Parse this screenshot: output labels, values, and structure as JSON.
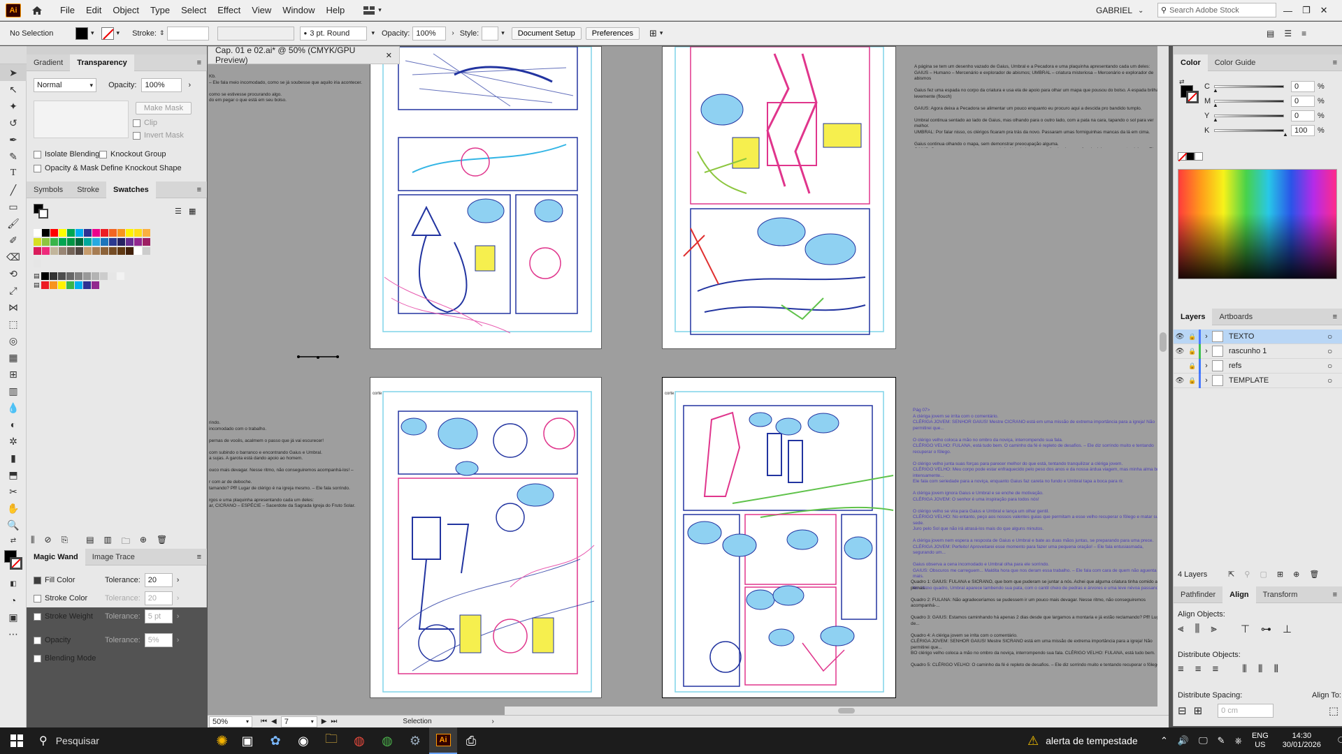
{
  "app": {
    "logo": "Ai",
    "user": "GABRIEL",
    "search_placeholder": "Search Adobe Stock"
  },
  "menu": [
    "File",
    "Edit",
    "Object",
    "Type",
    "Select",
    "Effect",
    "View",
    "Window",
    "Help"
  ],
  "control": {
    "selection": "No Selection",
    "stroke_label": "Stroke:",
    "brush": "3 pt. Round",
    "opacity_label": "Opacity:",
    "opacity": "100%",
    "style_label": "Style:",
    "doc_setup": "Document Setup",
    "preferences": "Preferences"
  },
  "document": {
    "tab_title": "Cap. 01 e 02.ai* @ 50% (CMYK/GPU Preview)"
  },
  "transparency_panel": {
    "tabs": [
      "Gradient",
      "Transparency"
    ],
    "blend_mode": "Normal",
    "opacity_label": "Opacity:",
    "opacity": "100%",
    "make_mask": "Make Mask",
    "clip": "Clip",
    "invert_mask": "Invert Mask",
    "isolate": "Isolate Blending",
    "knockout": "Knockout Group",
    "opacity_mask": "Opacity & Mask Define Knockout Shape"
  },
  "swatches_panel": {
    "tabs": [
      "Symbols",
      "Stroke",
      "Swatches"
    ]
  },
  "magic_wand_panel": {
    "tabs": [
      "Magic Wand",
      "Image Trace"
    ],
    "fill_color": "Fill Color",
    "stroke_color": "Stroke Color",
    "stroke_weight": "Stroke Weight",
    "opacity": "Opacity",
    "blending_mode": "Blending Mode",
    "tolerance_label": "Tolerance:",
    "fill_tolerance": "20",
    "stroke_color_tolerance": "20",
    "stroke_weight_tolerance": "5 pt",
    "opacity_tolerance": "5%"
  },
  "color_panel": {
    "tabs": [
      "Color",
      "Color Guide"
    ],
    "channels": [
      {
        "label": "C",
        "value": "0",
        "unit": "%"
      },
      {
        "label": "M",
        "value": "0",
        "unit": "%"
      },
      {
        "label": "Y",
        "value": "0",
        "unit": "%"
      },
      {
        "label": "K",
        "value": "100",
        "unit": "%"
      }
    ]
  },
  "layers_panel": {
    "tabs": [
      "Layers",
      "Artboards"
    ],
    "layers": [
      {
        "name": "TEXTO",
        "color": "#4a7bff"
      },
      {
        "name": "rascunho 1",
        "color": "#3cc050"
      },
      {
        "name": "refs",
        "color": "#3c78ff"
      },
      {
        "name": "TEMPLATE",
        "color": "#4a7bff"
      }
    ],
    "count": "4 Layers"
  },
  "align_panel": {
    "tabs": [
      "Pathfinder",
      "Align",
      "Transform"
    ],
    "align_objects": "Align Objects:",
    "distribute_objects": "Distribute Objects:",
    "distribute_spacing": "Distribute Spacing:",
    "align_to": "Align To:",
    "spacing_value": "0 cm"
  },
  "status": {
    "zoom": "50%",
    "page": "7",
    "tool": "Selection"
  },
  "artboards": {
    "label_corte": "corte"
  },
  "script_text": {
    "top_left": "Kb.\n– Ele fala meio incomodado, como se já soubesse que aquilo iria acontecer.\n\ncomo se estivesse procurando algo.\ndo em pegar o que está em seu bolso.",
    "mid_left": "rindo.\nincomodado com o trabalho.\n\npernas de vocês, acalmem o passo que já vai escurecer!\n\ncom subindo o barranco e encontrando Gaius e Umbral.\na sujas. A garota está dando apoio ao homem.\n\nouco mais devagar. Nesse ritmo, não conseguiremos acompanhá-los! –\n\nr com ar de deboche.\ntamando? Pff! Lugar de clérigo é na igreja mesmo. – Ele fala sorrindo.\n\nrgos e uma plaquinha apresentando cada um deles:\nar, CICRANO – ESPÉCIE – Sacerdote da Sagrada Igreja do Fruto Solar.",
    "top_right": "A página se tem um desenho vazado de Gaius, Umbral e a Pecadora e uma plaquinha apresentando cada um deles:\nGAIUS – Humano – Mercenário e explorador de abismos; UMBRAL – criatura misteriosa – Mercenário e explorador de abismos\n\nGaius fez uma espada no corpo da criatura e usa ela de apoio para olhar um mapa que pousou do bolso. A espada brilha levemente (flouch)\n\nGAIUS: Agora deixa a Pecadora se alimentar um pouco enquanto eu procuro aqui a descida pro bandido tumplo.\n\nUmbral continua sentado ao lado de Gaius, mas olhando para o outro lado, com a pata na cara, tapando o sol para ver melhor.\nUMBRAL: Por falar nisso, os clérigos ficaram pra trás da novo. Passaram umas formiguinhas mancas da lá em cima.\n\nGaius continua olhando o mapa, sem demonstrar preocupação alguma.\nGAIUS: Com sorte, aparece algum tamanduá abissal gigante e confunda eles com formiguinhas mancas também. – Ele responde",
    "bottom_right_purple": "Pág 07>\nA clériga jovem se irrita com o comentário.\nCLÉRIGA JOVEM: SENHOR GAIUS! Mestre CICRANO está em uma missão de extrema importância para a igreja! Não permitirei que...\n\nO clérigo velho coloca a mão no ombro da noviça, interrompendo sua fala.\nCLÉRIGO VELHO: FULANA, está tudo bem. O caminho da fé é repleto de desafios. – Ele diz sorrindo muito e tentando recuperar o fôlego.\n\nO clérigo velho junta suas forças para parecer melhor do que está, tentando tranquilizar a clériga jovem.\nCLÉRIGO VELHO: Meu corpo pode estar enfraquecido pelo peso dos anos e da nossa árdua viagem, mas minha alma brilha intensamente...\nEle fala com seriedade para a noviça, enquanto Gaius faz careta no fundo e Umbral tapa a boca para rir.\n\nA clériga jovem ignora Gaius e Umbral e se enche de motivação.\nCLÉRIGA JOVEM: O senhor é uma inspiração para todos nós!\n\nO clérigo velho se vira para Gaius e Umbral e lança um olhar gentil.\nCLÉRIGO VELHO: No entanto, peço aos nossos valentes guias que permitam a esse velho recuperar o fôlego e matar sua sede.\nJuro pelo Sol que não irá atrasá-los mais do que alguns minutos.\n\nA clériga jovem nem espera a resposta de Gaius e Umbral e bate as duas mãos juntas, se preparando para uma prece.\nCLÉRIGA JOVEM: Perfeito! Aproveitarei esse momento para fazer uma pequena oração! – Ele fala entusiasmada, segurando um...\n\nGaius observa a cena incomodado e Umbral olha para ele sorrindo.\nGAIUS: Obscuros me carreguem... Maldita hora que nos deram essa trabalho. – Ele fala com cara de quem não aguenta mais.\n\nNo último quadro, Umbral aparece lambendo sua pata, com o cantil cheio de pedras e árvores e uma leve névoa passando.",
    "bottom_right_black": "Quadro 1: GAIUS: FULANA e SICRANO, que bom que puderam se juntar a nós. Achei que alguma criatura tinha comido as pernas...\n\nQuadro 2: FULANA: Não agradeceríamos se pudessem ir um pouco mais devagar. Nesse ritmo, não conseguiremos acompanhá-...\n\nQuadro 3: GAIUS: Estamos caminhando há apenas 2 dias desde que largamos a montaria e já estão reclamando? Pff! Lugar de...\n\nQuadro 4: A clériga jovem se irrita com o comentário.\nCLÉRIGA JOVEM: SENHOR GAIUS! Mestre SICRANO está em uma missão de extrema importância para a igreja! Não permitirei que...\nBO clérigo velho coloca a mão no ombro da noviça, interrompendo sua fala. CLÉRIGO VELHO: FULANA, está tudo bem.\n\nQuadro 5: CLÉRIGO VELHO: O caminho da fé é repleto de desafios. – Ele diz sorrindo muito e tentando recuperar o fôlego."
  },
  "taskbar": {
    "search": "Pesquisar",
    "weather": "alerta de tempestade",
    "lang": "ENG",
    "region": "US",
    "time": "14:30",
    "date": "30/01/2026"
  },
  "colors": {
    "accent": "#0a64d8",
    "taskbar": "#1c1c1c",
    "panel": "#e8e8e8",
    "canvas": "#9e9e9e"
  }
}
